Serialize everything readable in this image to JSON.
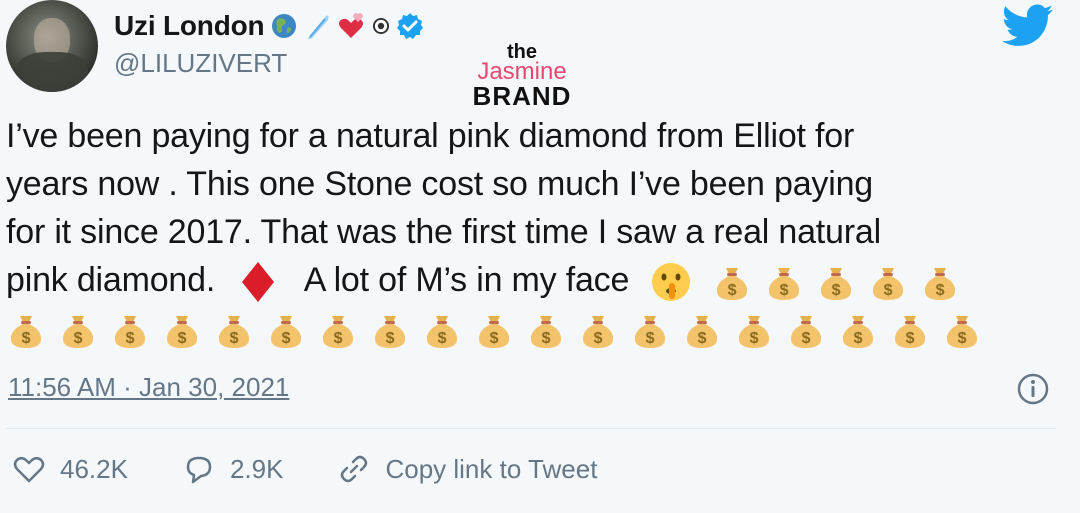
{
  "header": {
    "display_name": "Uzi London",
    "handle": "@LILUZIVERT",
    "name_emojis": [
      "globe-icon",
      "comet-icon",
      "hearts-icon",
      "record-icon",
      "verified-badge-icon"
    ]
  },
  "watermark": {
    "the": "the",
    "jasmine": "Jasmine",
    "brand": "BRAND"
  },
  "tweet": {
    "line1": "I’ve been paying for a natural pink diamond from Elliot for",
    "line2": "years now . This one Stone cost so much I’ve been paying",
    "line3": "for it since 2017. That was the first time I saw a real natural",
    "line4_a": "pink diamond.",
    "line4_b": "A lot of M’s in my face",
    "moneybags_line4": 5,
    "moneybags_line5": 19
  },
  "meta": {
    "timestamp": "11:56 AM · Jan 30, 2021"
  },
  "actions": {
    "likes": "46.2K",
    "replies": "2.9K",
    "copy_link": "Copy link to Tweet"
  },
  "colors": {
    "background": "#f5f8fa",
    "text": "#14171a",
    "secondary": "#657786",
    "twitter_blue": "#1da1f2",
    "diamond_red": "#d91e2a",
    "brand_pink": "#e8476e"
  }
}
